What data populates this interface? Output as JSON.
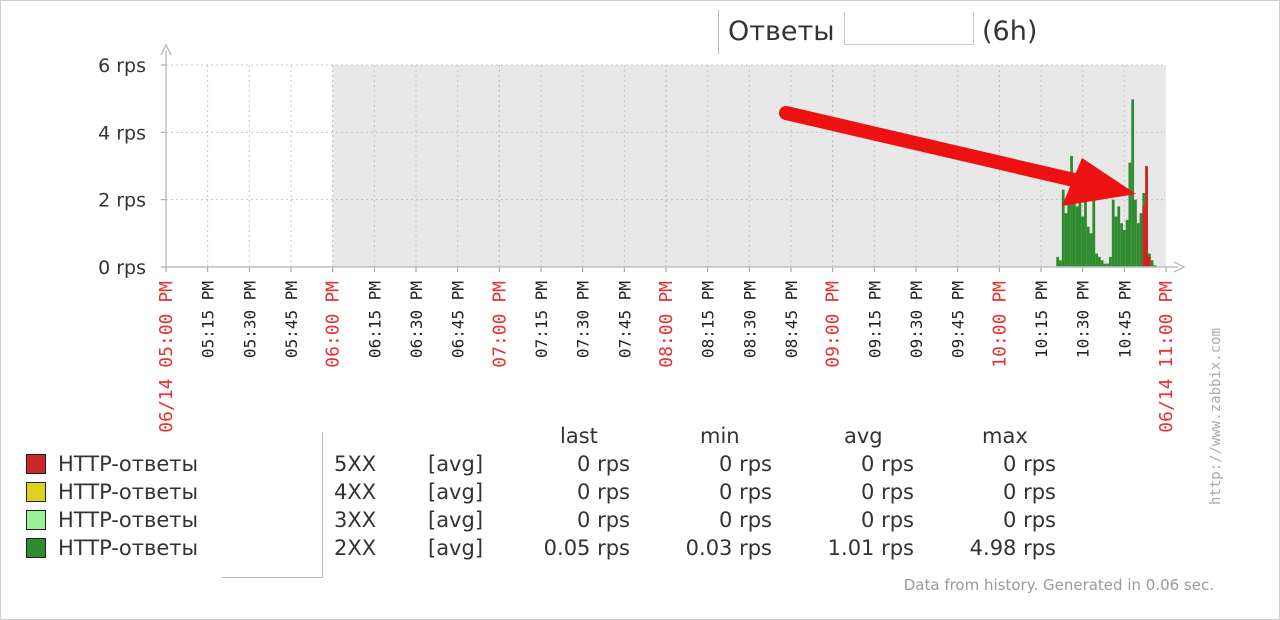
{
  "title": {
    "name": "Ответы",
    "period": "(6h)"
  },
  "chart_data": {
    "type": "area",
    "ylabel_unit": "rps",
    "ylim": [
      0,
      6
    ],
    "y_ticks": [
      "0 rps",
      "2 rps",
      "4 rps",
      "6 rps"
    ],
    "x_start": "06/14 05:00 PM",
    "x_end": "06/14 11:00 PM",
    "x_ticks": [
      "06/14 05:00 PM",
      "05:15 PM",
      "05:30 PM",
      "05:45 PM",
      "06:00 PM",
      "06:15 PM",
      "06:30 PM",
      "06:45 PM",
      "07:00 PM",
      "07:15 PM",
      "07:30 PM",
      "07:45 PM",
      "08:00 PM",
      "08:15 PM",
      "08:30 PM",
      "08:45 PM",
      "09:00 PM",
      "09:15 PM",
      "09:30 PM",
      "09:45 PM",
      "10:00 PM",
      "10:15 PM",
      "10:30 PM",
      "10:45 PM",
      "06/14 11:00 PM"
    ],
    "x_ticks_highlighted": [
      "06/14 05:00 PM",
      "06:00 PM",
      "07:00 PM",
      "08:00 PM",
      "09:00 PM",
      "10:00 PM",
      "06/14 11:00 PM"
    ],
    "no_data_until": "06:00 PM",
    "grid": true,
    "series": [
      {
        "name": "HTTP-ответы 2XX",
        "color": "#2e8b2e",
        "points": [
          [
            "10:21 PM",
            0.3
          ],
          [
            "10:22 PM",
            0.2
          ],
          [
            "10:23 PM",
            2.3
          ],
          [
            "10:24 PM",
            1.6
          ],
          [
            "10:25 PM",
            2.1
          ],
          [
            "10:26 PM",
            3.3
          ],
          [
            "10:27 PM",
            2.6
          ],
          [
            "10:28 PM",
            1.8
          ],
          [
            "10:29 PM",
            2.5
          ],
          [
            "10:30 PM",
            1.5
          ],
          [
            "10:31 PM",
            3.0
          ],
          [
            "10:32 PM",
            1.2
          ],
          [
            "10:33 PM",
            1.0
          ],
          [
            "10:34 PM",
            2.9
          ],
          [
            "10:35 PM",
            0.4
          ],
          [
            "10:36 PM",
            0.3
          ],
          [
            "10:37 PM",
            0.2
          ],
          [
            "10:38 PM",
            0.1
          ],
          [
            "10:39 PM",
            0.1
          ],
          [
            "10:40 PM",
            0.3
          ],
          [
            "10:41 PM",
            2.0
          ],
          [
            "10:42 PM",
            1.5
          ],
          [
            "10:43 PM",
            1.8
          ],
          [
            "10:44 PM",
            1.3
          ],
          [
            "10:45 PM",
            1.1
          ],
          [
            "10:46 PM",
            1.4
          ],
          [
            "10:47 PM",
            3.1
          ],
          [
            "10:48 PM",
            4.98
          ],
          [
            "10:49 PM",
            2.0
          ],
          [
            "10:50 PM",
            1.3
          ],
          [
            "10:51 PM",
            1.6
          ],
          [
            "10:52 PM",
            2.2
          ],
          [
            "10:53 PM",
            0.8
          ],
          [
            "10:54 PM",
            0.4
          ],
          [
            "10:55 PM",
            0.2
          ],
          [
            "10:56 PM",
            0.05
          ]
        ]
      },
      {
        "name": "HTTP-ответы 5XX",
        "color": "#cc2222",
        "points": [
          [
            "10:52 PM",
            1.8
          ],
          [
            "10:53 PM",
            3.0
          ],
          [
            "10:54 PM",
            0.3
          ],
          [
            "10:55 PM",
            0.0
          ]
        ]
      }
    ]
  },
  "legend": {
    "headers": {
      "last": "last",
      "min": "min",
      "avg": "avg",
      "max": "max"
    },
    "rows": [
      {
        "color": "#c62828",
        "name": "HTTP-ответы",
        "code": "5XX",
        "func": "[avg]",
        "last": "0 rps",
        "min": "0 rps",
        "avg": "0 rps",
        "max": "0 rps"
      },
      {
        "color": "#e0d020",
        "name": "HTTP-ответы",
        "code": "4XX",
        "func": "[avg]",
        "last": "0 rps",
        "min": "0 rps",
        "avg": "0 rps",
        "max": "0 rps"
      },
      {
        "color": "#99f099",
        "name": "HTTP-ответы",
        "code": "3XX",
        "func": "[avg]",
        "last": "0 rps",
        "min": "0 rps",
        "avg": "0 rps",
        "max": "0 rps"
      },
      {
        "color": "#2e8b2e",
        "name": "HTTP-ответы",
        "code": "2XX",
        "func": "[avg]",
        "last": "0.05 rps",
        "min": "0.03 rps",
        "avg": "1.01 rps",
        "max": "4.98 rps"
      }
    ]
  },
  "footer": "Data from history. Generated in 0.06 sec.",
  "watermark": "http://www.zabbix.com",
  "annotation_arrow_color": "#ee1111"
}
